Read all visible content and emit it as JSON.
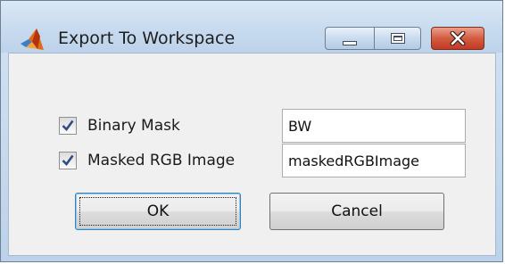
{
  "window": {
    "title": "Export To Workspace",
    "icon": "matlab-logo-icon"
  },
  "titlebar_controls": [
    {
      "name": "minimize",
      "icon": "minimize-icon"
    },
    {
      "name": "maximize",
      "icon": "maximize-icon"
    },
    {
      "name": "close",
      "icon": "close-icon"
    }
  ],
  "options": {
    "binary_mask": {
      "label": "Binary Mask",
      "checked": true,
      "value": "BW"
    },
    "masked_rgb": {
      "label": "Masked RGB Image",
      "checked": true,
      "value": "maskedRGBImage"
    }
  },
  "buttons": {
    "ok_label": "OK",
    "cancel_label": "Cancel"
  },
  "colors": {
    "titlebar": "#c6d9ee",
    "close_button": "#c23a22",
    "dialog_background": "#f0f0f0",
    "default_button_border": "#3c7fb1"
  }
}
